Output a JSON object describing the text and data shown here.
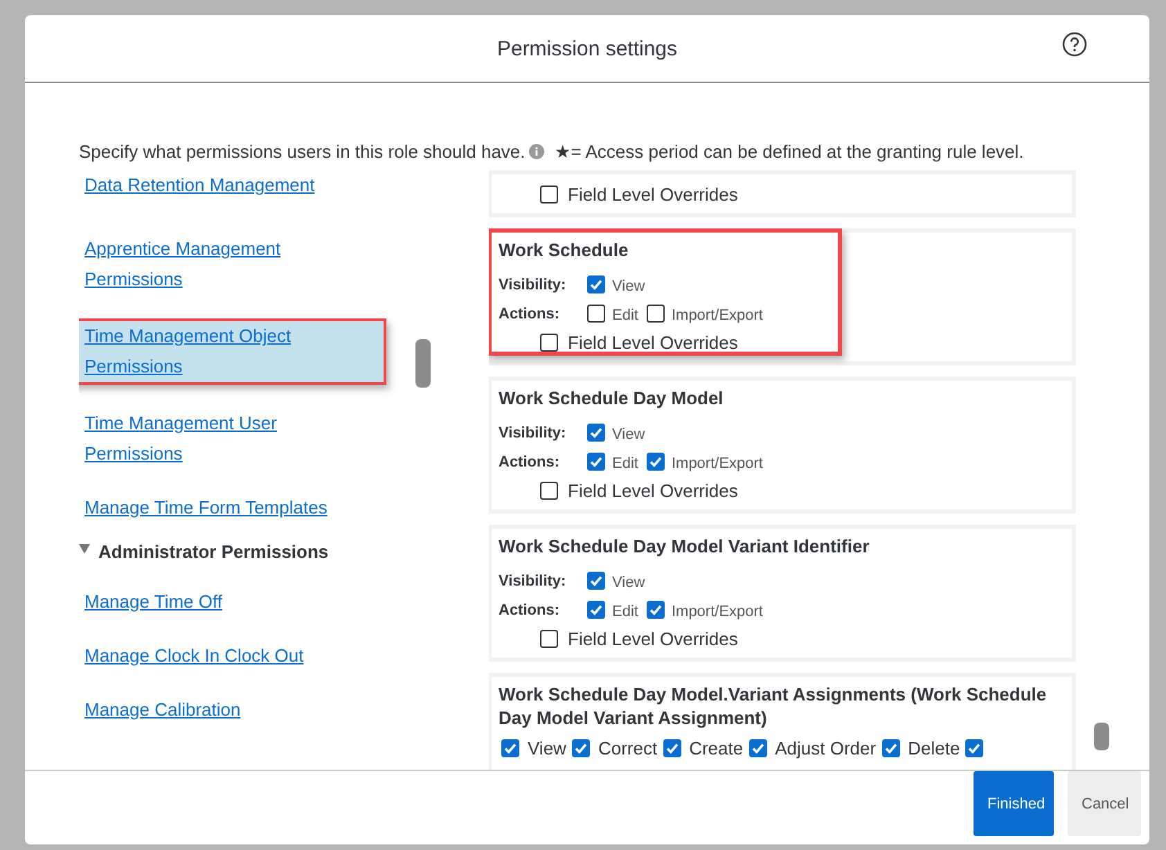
{
  "dialog": {
    "title": "Permission settings",
    "description": "Specify what permissions users in this role should have.",
    "legend": "★= Access period can be defined at the granting rule level."
  },
  "sidebar": {
    "items": [
      {
        "kind": "link",
        "label": "Data Retention Management",
        "selected": false,
        "highlighted": false
      },
      {
        "kind": "link",
        "label": "Apprentice Management Permissions",
        "selected": false,
        "highlighted": false
      },
      {
        "kind": "link",
        "label": "Time Management Object Permissions",
        "selected": true,
        "highlighted": true
      },
      {
        "kind": "link",
        "label": "Time Management User Permissions",
        "selected": false,
        "highlighted": false
      },
      {
        "kind": "link",
        "label": "Manage Time Form Templates",
        "selected": false,
        "highlighted": false
      },
      {
        "kind": "group",
        "label": "Administrator Permissions",
        "expanded": true
      },
      {
        "kind": "link",
        "label": "Manage Time Off",
        "selected": false,
        "highlighted": false
      },
      {
        "kind": "link",
        "label": "Manage Clock In Clock Out",
        "selected": false,
        "highlighted": false
      },
      {
        "kind": "link",
        "label": "Manage Calibration",
        "selected": false,
        "highlighted": false
      }
    ]
  },
  "panels": [
    {
      "kind": "tail",
      "highlighted": false,
      "field_level_overrides": {
        "label": "Field Level Overrides",
        "checked": false
      }
    },
    {
      "kind": "standard",
      "title": "Work Schedule",
      "highlighted": true,
      "visibility_label": "Visibility:",
      "visibility": [
        {
          "label": "View",
          "checked": true
        }
      ],
      "actions_label": "Actions:",
      "actions": [
        {
          "label": "Edit",
          "checked": false
        },
        {
          "label": "Import/Export",
          "checked": false
        }
      ],
      "field_level_overrides": {
        "label": "Field Level Overrides",
        "checked": false
      }
    },
    {
      "kind": "standard",
      "title": "Work Schedule Day Model",
      "highlighted": false,
      "visibility_label": "Visibility:",
      "visibility": [
        {
          "label": "View",
          "checked": true
        }
      ],
      "actions_label": "Actions:",
      "actions": [
        {
          "label": "Edit",
          "checked": true
        },
        {
          "label": "Import/Export",
          "checked": true
        }
      ],
      "field_level_overrides": {
        "label": "Field Level Overrides",
        "checked": false
      }
    },
    {
      "kind": "standard",
      "title": "Work Schedule Day Model Variant Identifier",
      "highlighted": false,
      "visibility_label": "Visibility:",
      "visibility": [
        {
          "label": "View",
          "checked": true
        }
      ],
      "actions_label": "Actions:",
      "actions": [
        {
          "label": "Edit",
          "checked": true
        },
        {
          "label": "Import/Export",
          "checked": true
        }
      ],
      "field_level_overrides": {
        "label": "Field Level Overrides",
        "checked": false
      }
    },
    {
      "kind": "inline",
      "title": "Work Schedule Day Model.Variant Assignments (Work Schedule Day Model Variant Assignment)",
      "highlighted": false,
      "options": [
        {
          "label": "View",
          "checked": true
        },
        {
          "label": "Correct",
          "checked": true
        },
        {
          "label": "Create",
          "checked": true
        },
        {
          "label": "Adjust Order",
          "checked": true
        },
        {
          "label": "Delete",
          "checked": true
        },
        {
          "checked": true
        }
      ]
    }
  ],
  "buttons": [
    {
      "kind": "primary",
      "label": "Finished"
    },
    {
      "kind": "secondary",
      "label": "Cancel"
    }
  ]
}
